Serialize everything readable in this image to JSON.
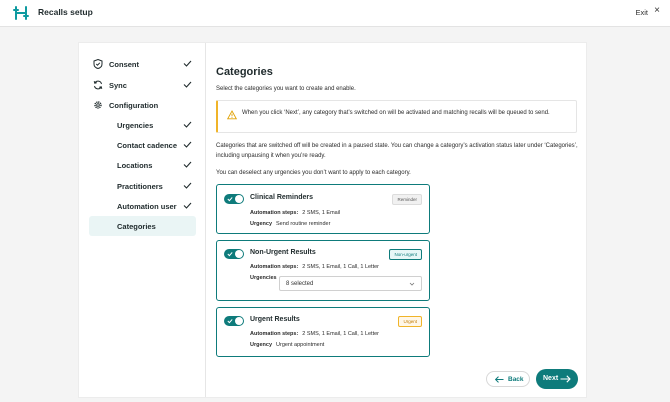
{
  "app": {
    "title": "Recalls setup",
    "logo_icon": "letter-h-logo-icon",
    "exit_label": "Exit",
    "close_glyph": "×"
  },
  "sidebar": {
    "items": [
      {
        "label": "Consent",
        "icon": "shield-icon",
        "done": true
      },
      {
        "label": "Sync",
        "icon": "sync-icon",
        "done": true
      },
      {
        "label": "Configuration",
        "icon": "gear-icon",
        "done": false
      },
      {
        "label": "Urgencies",
        "done": true
      },
      {
        "label": "Contact cadence",
        "done": true
      },
      {
        "label": "Locations",
        "done": true
      },
      {
        "label": "Practitioners",
        "done": true
      },
      {
        "label": "Automation user",
        "done": true
      },
      {
        "label": "Categories",
        "done": false,
        "active": true
      }
    ]
  },
  "main": {
    "title": "Categories",
    "intro": "Select the categories you want to create and enable.",
    "warning": "When you click ‘Next’, any category that’s switched on will be activated and matching recalls will be queued to send.",
    "paragraph1": "Categories that are switched off will be created in a paused state. You can change a category’s activation status later under ‘Categories’, including unpausing it when you’re ready.",
    "paragraph2": "You can deselect any urgencies you don’t want to apply to each category.",
    "steps_label": "Automation steps:",
    "urgency_label": "Urgency",
    "urgencies_label": "Urgencies",
    "cards": [
      {
        "title": "Clinical Reminders",
        "badge": "Reminder",
        "steps": "2 SMS, 1 Email",
        "urgency": "Send routine reminder",
        "enabled": true
      },
      {
        "title": "Non-Urgent Results",
        "badge": "Non-urgent",
        "steps": "2 SMS, 1 Email, 1 Call, 1 Letter",
        "urgencies_selected": "8 selected",
        "enabled": true
      },
      {
        "title": "Urgent Results",
        "badge": "Urgent",
        "steps": "2 SMS, 1 Email, 1 Call, 1 Letter",
        "urgency": "Urgent appointment",
        "enabled": true
      }
    ],
    "back_label": "Back",
    "next_label": "Next"
  },
  "colors": {
    "accent": "#0e7b7b",
    "warning": "#f0b429",
    "active_bg": "#eaf5f5"
  }
}
